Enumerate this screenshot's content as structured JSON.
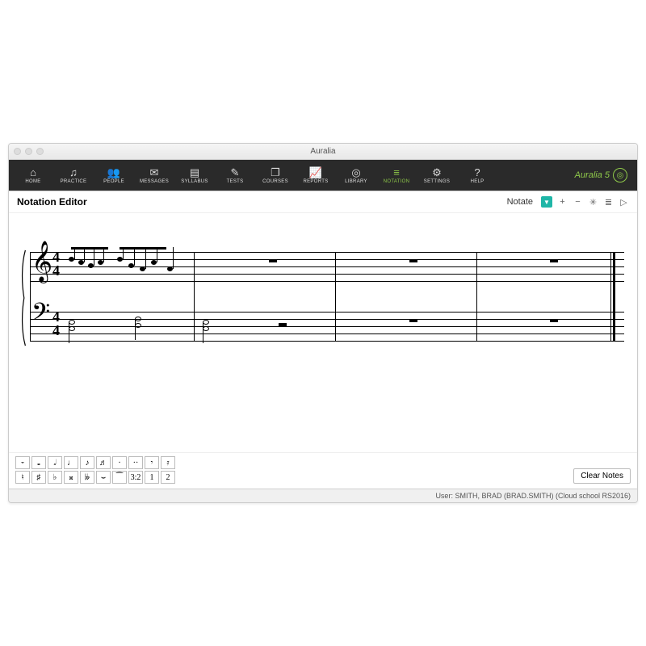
{
  "window": {
    "title": "Auralia"
  },
  "brand": {
    "name": "Auralia 5"
  },
  "menu": {
    "items": [
      {
        "id": "home",
        "label": "HOME",
        "glyph": "⌂",
        "active": false
      },
      {
        "id": "practice",
        "label": "PRACTICE",
        "glyph": "♫",
        "active": false
      },
      {
        "id": "people",
        "label": "PEOPLE",
        "glyph": "👥",
        "active": false
      },
      {
        "id": "messages",
        "label": "MESSAGES",
        "glyph": "✉",
        "active": false
      },
      {
        "id": "syllabus",
        "label": "SYLLABUS",
        "glyph": "▤",
        "active": false
      },
      {
        "id": "tests",
        "label": "TESTS",
        "glyph": "✎",
        "active": false
      },
      {
        "id": "courses",
        "label": "COURSES",
        "glyph": "❐",
        "active": false
      },
      {
        "id": "reports",
        "label": "REPORTS",
        "glyph": "📈",
        "active": false
      },
      {
        "id": "library",
        "label": "LIBRARY",
        "glyph": "◎",
        "active": false
      },
      {
        "id": "notation",
        "label": "NOTATION",
        "glyph": "≡",
        "active": true
      },
      {
        "id": "settings",
        "label": "SETTINGS",
        "glyph": "⚙",
        "active": false
      },
      {
        "id": "help",
        "label": "HELP",
        "glyph": "?",
        "active": false
      }
    ]
  },
  "editor": {
    "title": "Notation Editor",
    "mode": "Notate",
    "tools": {
      "dropdown": "▼",
      "add": "+",
      "remove": "−",
      "settings": "✳",
      "list": "≣",
      "play": "▷"
    },
    "time_signature": {
      "top": "4",
      "bottom": "4"
    }
  },
  "palette": {
    "row1": [
      "⏑",
      "𝅝",
      "𝅗𝅥",
      "♩",
      "♪",
      "♬",
      "·",
      "··",
      "𝄾",
      "𝄿"
    ],
    "row2": [
      "♮",
      "♯",
      "♭",
      "𝄪",
      "𝄫",
      "⌣",
      "⁀",
      "3:2",
      "1",
      "2"
    ]
  },
  "buttons": {
    "clear": "Clear Notes"
  },
  "status": {
    "user": "User: SMITH, BRAD (BRAD.SMITH) (Cloud school RS2016)"
  }
}
